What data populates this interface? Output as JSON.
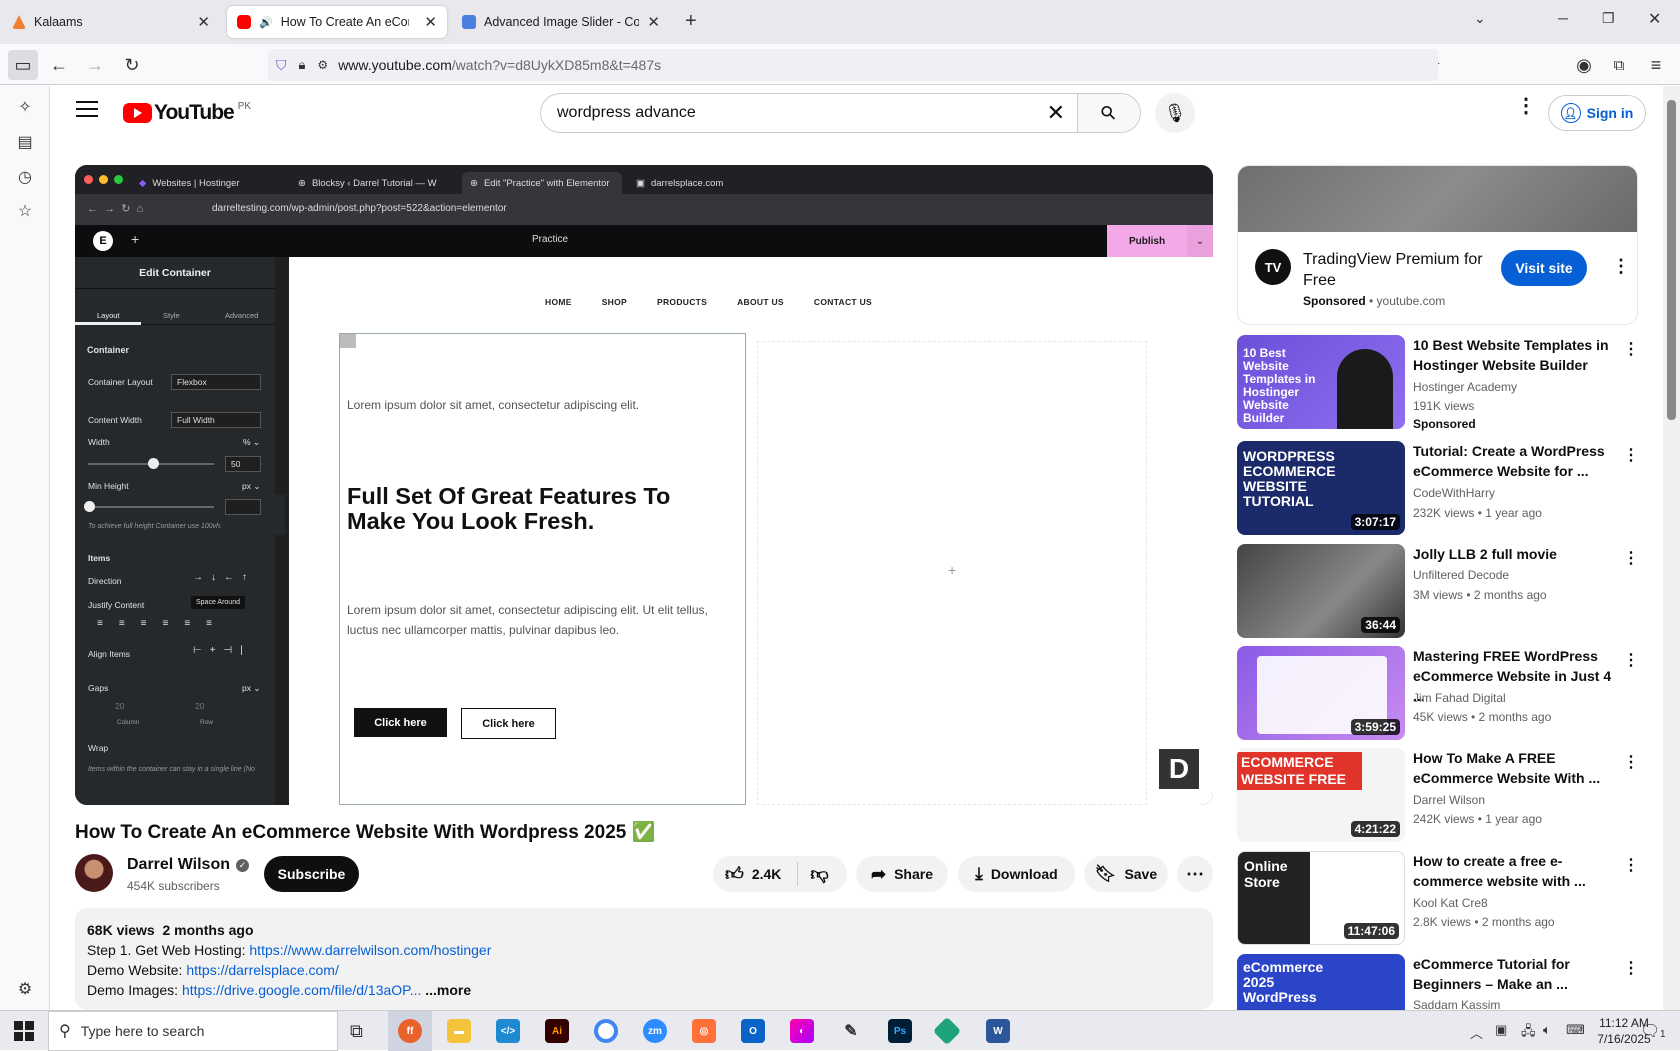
{
  "browser": {
    "tabs": [
      {
        "title": "Kalaams"
      },
      {
        "title": "How To Create An eCommerce"
      },
      {
        "title": "Advanced Image Slider - Code"
      }
    ],
    "url_domain": "www.youtube.com",
    "url_path": "/watch?v=d8UykXD85m8&t=487s"
  },
  "youtube": {
    "logo_text": "YouTube",
    "region": "PK",
    "search_value": "wordpress advance",
    "signin_label": "Sign in"
  },
  "video_frame": {
    "tabs": [
      "Websites | Hostinger",
      "Blocksy ‹ Darrel Tutorial — W",
      "Edit \"Practice\" with Elementor",
      "darrelsplace.com"
    ],
    "url": "darreltesting.com/wp-admin/post.php?post=522&action=elementor",
    "page_name": "Practice",
    "publish_label": "Publish",
    "panel_title": "Edit Container",
    "panel_tabs": [
      "Layout",
      "Style",
      "Advanced"
    ],
    "section_container": "Container",
    "container_layout_label": "Container Layout",
    "container_layout_value": "Flexbox",
    "content_width_label": "Content Width",
    "content_width_value": "Full Width",
    "width_label": "Width",
    "width_unit": "% ⌄",
    "width_value": "50",
    "min_height_label": "Min Height",
    "min_height_unit": "px ⌄",
    "min_height_hint": "To achieve full height Container use 100vh.",
    "items_label": "Items",
    "direction_label": "Direction",
    "justify_label": "Justify Content",
    "justify_tooltip": "Space Around",
    "align_label": "Align Items",
    "gaps_label": "Gaps",
    "gaps_unit": "px ⌄",
    "gap_column": "20",
    "gap_row": "20",
    "gap_column_label": "Column",
    "gap_row_label": "Row",
    "wrap_label": "Wrap",
    "wrap_hint": "Items within the container can stay in a single line (No",
    "site_nav": [
      "HOME",
      "SHOP",
      "PRODUCTS",
      "ABOUT US",
      "CONTACT US"
    ],
    "lorem1": "Lorem ipsum dolor sit amet, consectetur adipiscing elit.",
    "headline": "Full Set Of Great Features To Make You Look Fresh.",
    "lorem2": "Lorem ipsum dolor sit amet, consectetur adipiscing elit. Ut elit tellus, luctus nec ullamcorper mattis, pulvinar dapibus leo.",
    "btn1": "Click here",
    "btn2": "Click here"
  },
  "video": {
    "title": "How To Create An eCommerce Website With Wordpress 2025 ✅",
    "channel": "Darrel Wilson",
    "subscribers": "454K subscribers",
    "subscribe_label": "Subscribe",
    "likes": "2.4K",
    "share_label": "Share",
    "download_label": "Download",
    "save_label": "Save",
    "views": "68K views",
    "age": "2 months ago",
    "desc": [
      {
        "text": "Step 1. Get Web Hosting: ",
        "link": "https://www.darrelwilson.com/hostinger"
      },
      {
        "text": "Demo Website: ",
        "link": "https://darrelsplace.com/"
      },
      {
        "text": "Demo Images: ",
        "link": "https://drive.google.com/file/d/13aOP..."
      }
    ],
    "more_label": "...more"
  },
  "ad": {
    "title": "TradingView Premium for Free",
    "sponsored": "Sponsored",
    "domain": "youtube.com",
    "cta": "Visit site"
  },
  "recs": [
    {
      "title": "10 Best Website Templates in Hostinger Website Builder",
      "channel": "Hostinger Academy",
      "meta": "191K views",
      "extra": "Sponsored",
      "duration": "",
      "thumb_text": "10 Best Website Templates in Hostinger Website Builder"
    },
    {
      "title": "Tutorial: Create a WordPress eCommerce Website for ...",
      "channel": "CodeWithHarry",
      "meta": "232K views • 1 year ago",
      "extra": "",
      "duration": "3:07:17",
      "thumb_text": "WORDPRESS ECOMMERCE WEBSITE TUTORIAL"
    },
    {
      "title": "Jolly LLB 2 full movie",
      "channel": "Unfiltered Decode",
      "meta": "3M views • 2 months ago",
      "extra": "",
      "duration": "36:44",
      "thumb_text": ""
    },
    {
      "title": "Mastering FREE WordPress eCommerce Website in Just 4 ...",
      "channel": "Jim Fahad Digital",
      "meta": "45K views • 2 months ago",
      "extra": "",
      "duration": "3:59:25",
      "thumb_text": ""
    },
    {
      "title": "How To Make A FREE eCommerce Website With ...",
      "channel": "Darrel Wilson",
      "meta": "242K views • 1 year ago",
      "extra": "",
      "duration": "4:21:22",
      "thumb_text": "ECOMMERCE WEBSITE FREE"
    },
    {
      "title": "How to create a free e-commerce website with ...",
      "channel": "Kool Kat Cre8",
      "meta": "2.8K views • 2 months ago",
      "extra": "",
      "duration": "11:47:06",
      "thumb_text": "Online Store"
    },
    {
      "title": "eCommerce Tutorial for Beginners – Make an ...",
      "channel": "Saddam Kassim",
      "meta": "",
      "extra": "",
      "duration": "",
      "thumb_text": "eCommerce 2025 WordPress"
    }
  ],
  "taskbar": {
    "search_placeholder": "Type here to search",
    "time": "11:12 AM",
    "date": "7/16/2025",
    "notif_count": "1"
  },
  "colors": {
    "youtube_red": "#ff0000",
    "link_blue": "#065fd4",
    "elementor_pink": "#f3a8e8"
  }
}
